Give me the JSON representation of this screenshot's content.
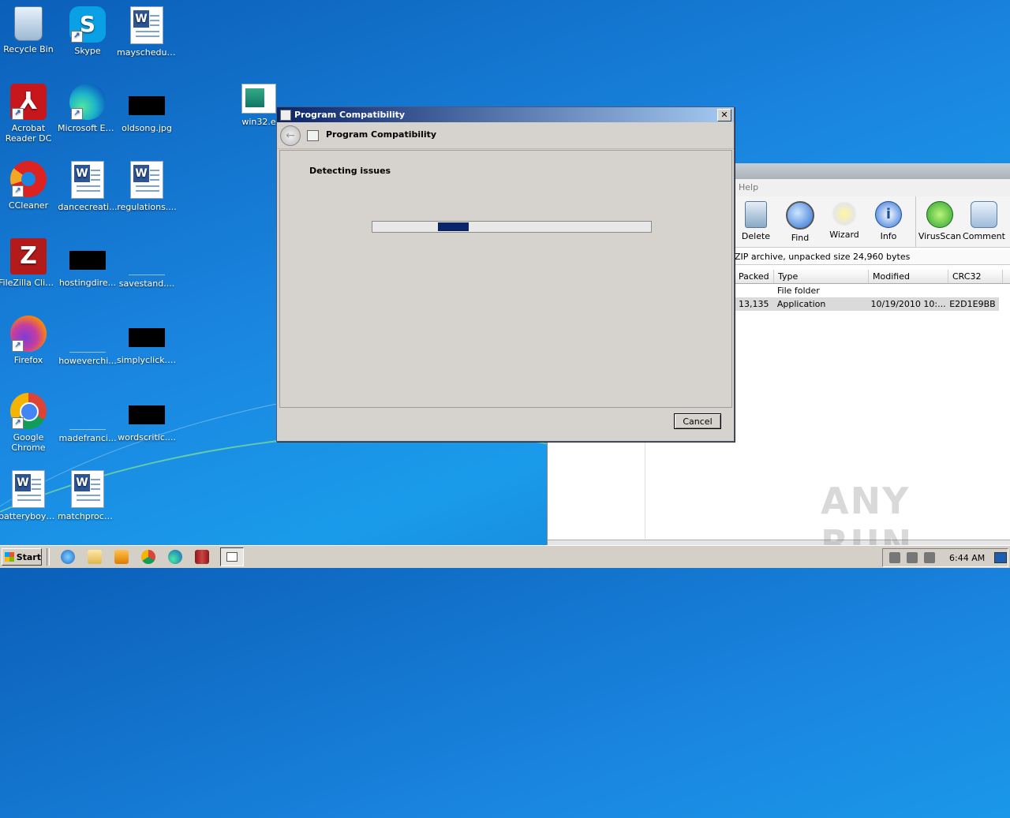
{
  "desktop": {
    "icons": [
      {
        "label": "Recycle Bin"
      },
      {
        "label": "Skype"
      },
      {
        "label": "mayschedul..."
      },
      {
        "label": "Acrobat Reader DC"
      },
      {
        "label": "Microsoft Edge"
      },
      {
        "label": "oldsong.jpg"
      },
      {
        "label": "win32.e"
      },
      {
        "label": "CCleaner"
      },
      {
        "label": "dancecreati..."
      },
      {
        "label": "regulations...."
      },
      {
        "label": "FileZilla Client"
      },
      {
        "label": "hostingdire..."
      },
      {
        "label": "savestand...."
      },
      {
        "label": "Firefox"
      },
      {
        "label": "howeverchi..."
      },
      {
        "label": "simplyclick.jpg"
      },
      {
        "label": "Google Chrome"
      },
      {
        "label": "madefranci..."
      },
      {
        "label": "wordscritic...."
      },
      {
        "label": "batteryboys...."
      },
      {
        "label": "matchproce...."
      }
    ]
  },
  "archive_window": {
    "menu_help": "Help",
    "toolbar": [
      {
        "label": "Delete"
      },
      {
        "label": "Find"
      },
      {
        "label": "Wizard"
      },
      {
        "label": "Info"
      },
      {
        "label": "VirusScan"
      },
      {
        "label": "Comment"
      }
    ],
    "info": "ZIP archive, unpacked size 24,960 bytes",
    "columns": [
      "Packed",
      "Type",
      "Modified",
      "CRC32"
    ],
    "rows": [
      {
        "packed": "",
        "type": "File folder",
        "modified": "",
        "crc": ""
      },
      {
        "packed": "13,135",
        "type": "Application",
        "modified": "10/19/2010 10:...",
        "crc": "E2D1E9BB"
      }
    ]
  },
  "dialog": {
    "window_title": "Program Compatibility",
    "nav_title": "Program Compatibility",
    "heading": "Detecting issues",
    "progress": {
      "fill_start": 0.235,
      "fill_end": 0.345
    },
    "cancel_label": "Cancel",
    "close_glyph": "✕"
  },
  "taskbar": {
    "start_label": "Start",
    "clock": "6:44 AM"
  },
  "watermark": "ANY RUN",
  "colors": {
    "title_gradient_start": "#0a246a",
    "title_gradient_end": "#a6caf0",
    "progress_fill": "#0a246a"
  }
}
